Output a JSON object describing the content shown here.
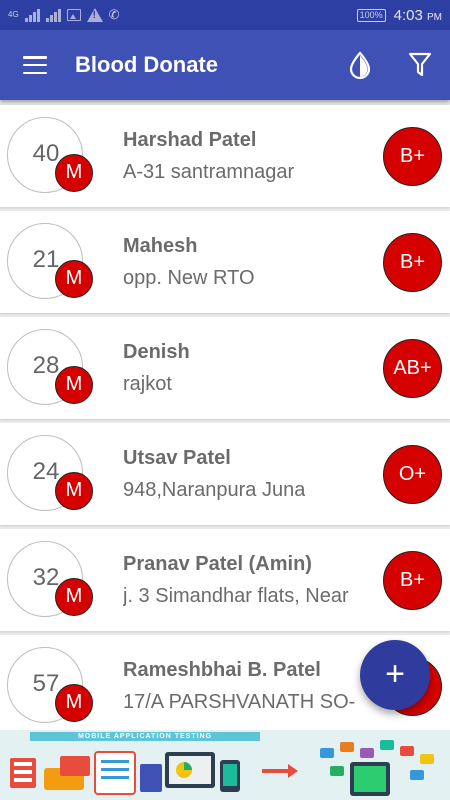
{
  "status_bar": {
    "network": "4G",
    "battery": "100%",
    "time": "4:03",
    "ampm": "PM"
  },
  "toolbar": {
    "title": "Blood Donate",
    "icons": [
      "menu-icon",
      "blood-drop-icon",
      "filter-icon"
    ]
  },
  "donors": [
    {
      "age": "40",
      "gender": "M",
      "name": "Harshad Patel",
      "address": "A-31 santramnagar",
      "blood_group": "B+"
    },
    {
      "age": "21",
      "gender": "M",
      "name": "Mahesh",
      "address": "opp. New RTO",
      "blood_group": "B+"
    },
    {
      "age": "28",
      "gender": "M",
      "name": "Denish",
      "address": "rajkot",
      "blood_group": "AB+"
    },
    {
      "age": "24",
      "gender": "M",
      "name": "Utsav Patel",
      "address": "948,Naranpura Juna",
      "blood_group": "O+"
    },
    {
      "age": "32",
      "gender": "M",
      "name": "Pranav Patel (Amin)",
      "address": "j. 3 Simandhar flats, Near",
      "blood_group": "B+"
    },
    {
      "age": "57",
      "gender": "M",
      "name": "Rameshbhai B. Patel",
      "address": "17/A PARSHVANATH SO-",
      "blood_group": ""
    }
  ],
  "fab": {
    "label": "+"
  },
  "ad": {
    "title": "MOBILE APPLICATION TESTING"
  },
  "colors": {
    "primary": "#3f51b5",
    "status_bar": "#2d3fa3",
    "badge_red": "#d50000",
    "fab": "#2f3c9e"
  }
}
